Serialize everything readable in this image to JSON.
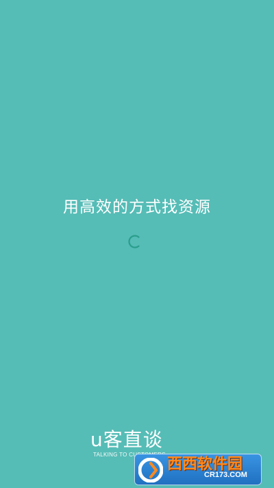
{
  "splash": {
    "slogan": "用高效的方式找资源",
    "loading_indicator": "loading-spinner"
  },
  "brand": {
    "name": "u客直谈",
    "tagline": "TALKING TO CUSTOMERS"
  },
  "watermark": {
    "brand": "西西软件园",
    "site": "CR173.COM"
  },
  "colors": {
    "background": "#56bcb6",
    "text": "#ffffff",
    "spinner": "#2a9e8c"
  }
}
